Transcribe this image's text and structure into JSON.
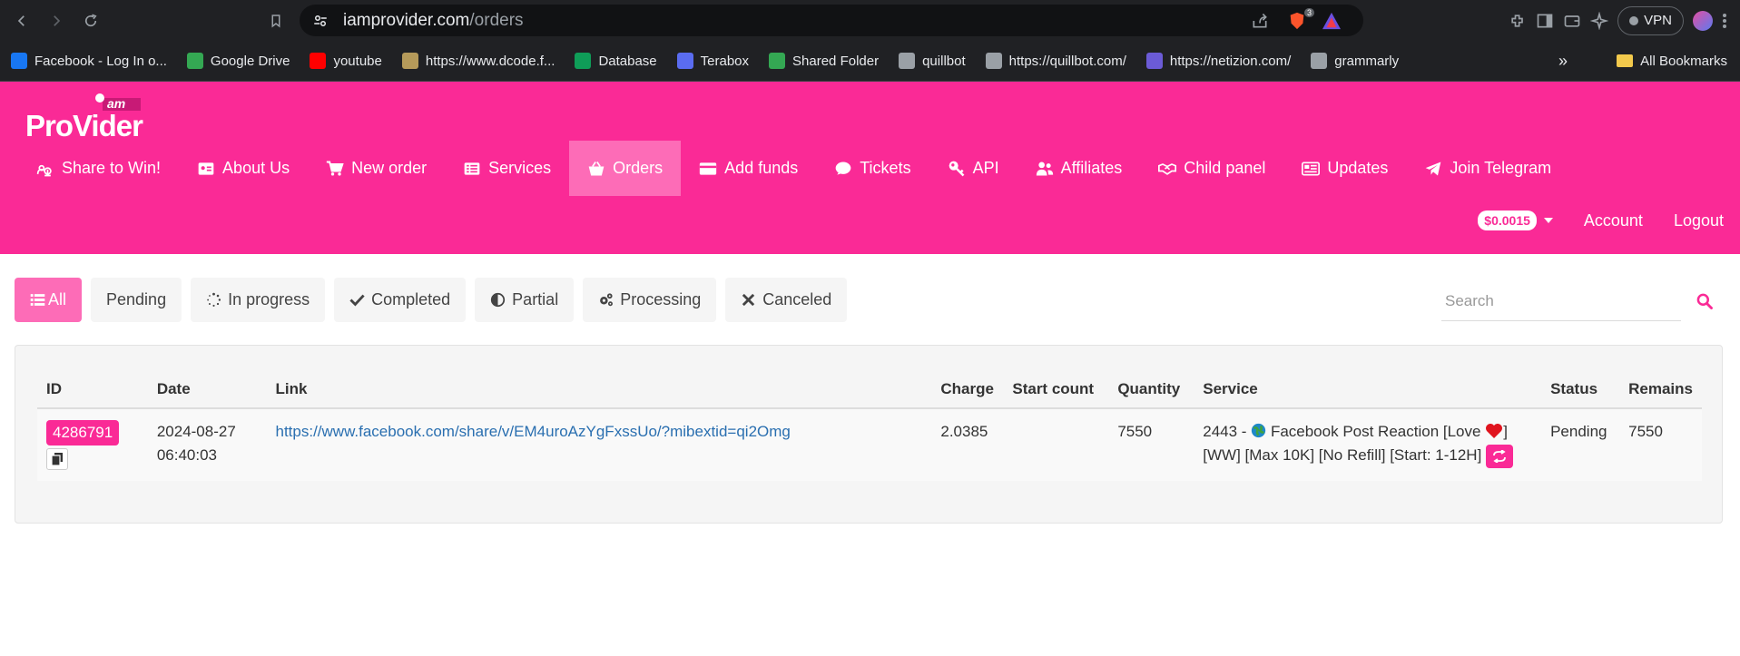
{
  "browser": {
    "url_domain": "iamprovider.com",
    "url_path": "/orders",
    "vpn_label": "VPN",
    "brave_badge": "3",
    "bookmarks": [
      {
        "label": "Facebook - Log In o...",
        "icon": "facebook-icon",
        "color": "#1877f2"
      },
      {
        "label": "Google Drive",
        "icon": "google-drive-icon",
        "color": "#34a853"
      },
      {
        "label": "youtube",
        "icon": "youtube-icon",
        "color": "#ff0000"
      },
      {
        "label": "https://www.dcode.f...",
        "icon": "dcode-icon",
        "color": "#b59a5a"
      },
      {
        "label": "Database",
        "icon": "sheets-icon",
        "color": "#0f9d58"
      },
      {
        "label": "Terabox",
        "icon": "terabox-icon",
        "color": "#5a6cf0"
      },
      {
        "label": "Shared Folder",
        "icon": "google-drive-icon",
        "color": "#34a853"
      },
      {
        "label": "quillbot",
        "icon": "quillbot-icon",
        "color": "#9aa0a6"
      },
      {
        "label": "https://quillbot.com/",
        "icon": "feather-icon",
        "color": "#9aa0a6"
      },
      {
        "label": "https://netizion.com/",
        "icon": "netizion-icon",
        "color": "#6b5bd6"
      },
      {
        "label": "grammarly",
        "icon": "grammarly-icon",
        "color": "#9aa0a6"
      }
    ],
    "all_bookmarks_label": "All Bookmarks"
  },
  "site": {
    "logo_text_small": "am",
    "logo_text_main": "ProVider",
    "accent_color": "#fa2a96",
    "nav": [
      {
        "label": "Share to Win!",
        "icon": "users-cog-icon"
      },
      {
        "label": "About Us",
        "icon": "id-card-icon"
      },
      {
        "label": "New order",
        "icon": "cart-icon"
      },
      {
        "label": "Services",
        "icon": "list-icon"
      },
      {
        "label": "Orders",
        "icon": "basket-icon",
        "active": true
      },
      {
        "label": "Add funds",
        "icon": "credit-card-icon"
      },
      {
        "label": "Tickets",
        "icon": "comment-icon"
      },
      {
        "label": "API",
        "icon": "key-icon"
      },
      {
        "label": "Affiliates",
        "icon": "users-icon"
      },
      {
        "label": "Child panel",
        "icon": "handshake-icon"
      },
      {
        "label": "Updates",
        "icon": "newspaper-icon"
      },
      {
        "label": "Join Telegram",
        "icon": "telegram-icon"
      }
    ],
    "balance": "$0.0015",
    "account_label": "Account",
    "logout_label": "Logout"
  },
  "filters": [
    {
      "label": "All",
      "icon": "list-icon",
      "active": true
    },
    {
      "label": "Pending",
      "icon": ""
    },
    {
      "label": "In progress",
      "icon": "spinner-icon"
    },
    {
      "label": "Completed",
      "icon": "check-icon"
    },
    {
      "label": "Partial",
      "icon": "half-circle-icon"
    },
    {
      "label": "Processing",
      "icon": "cogs-icon"
    },
    {
      "label": "Canceled",
      "icon": "times-icon"
    }
  ],
  "search": {
    "placeholder": "Search"
  },
  "table": {
    "headers": [
      "ID",
      "Date",
      "Link",
      "Charge",
      "Start count",
      "Quantity",
      "Service",
      "Status",
      "Remains"
    ],
    "rows": [
      {
        "id": "4286791",
        "date_line1": "2024-08-27",
        "date_line2": "06:40:03",
        "link": "https://www.facebook.com/share/v/EM4uroAzYgFxssUo/?mibextid=qi2Omg",
        "charge": "2.0385",
        "start_count": "",
        "quantity": "7550",
        "service_prefix": "2443 - ",
        "service_name": "Facebook Post Reaction [Love ",
        "service_suffix": "]",
        "service_line2": "[WW] [Max 10K] [No Refill] [Start: 1-12H]",
        "status": "Pending",
        "remains": "7550"
      }
    ]
  }
}
